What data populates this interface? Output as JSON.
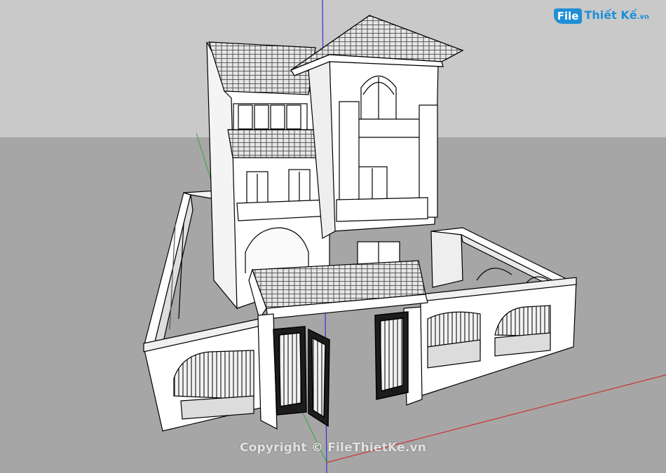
{
  "watermark": {
    "text": "Copyright © FileThietKe.vn"
  },
  "logo": {
    "file_part": "File",
    "name_part": "Thiết Kế",
    "domain_part": ".vn",
    "brand_color": "#1e8fd6"
  },
  "scene": {
    "description_colors": {
      "sky": "#c8c8c8",
      "ground": "#a5a5a5",
      "wall": "#ffffff",
      "line": "#000000",
      "axis_blue": "#3b3bd6",
      "axis_red": "#cc3333",
      "axis_green": "#33aa33"
    }
  }
}
